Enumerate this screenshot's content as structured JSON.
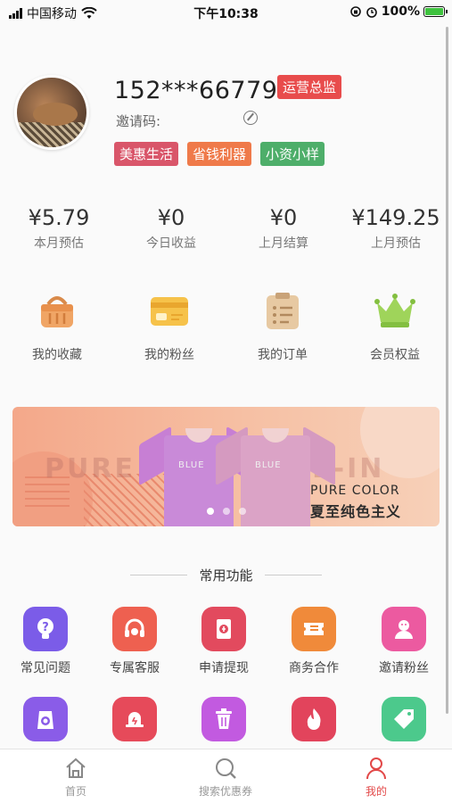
{
  "status_bar": {
    "carrier": "中国移动",
    "time": "下午10:38",
    "battery": "100%"
  },
  "profile": {
    "phone": "152***66779",
    "role_badge": "运营总监",
    "invite_label": "邀请码:",
    "tags": [
      {
        "label": "美惠生活",
        "color": "#d9566a"
      },
      {
        "label": "省钱利器",
        "color": "#ef7a4a"
      },
      {
        "label": "小资小样",
        "color": "#4eae6a"
      }
    ]
  },
  "stats": [
    {
      "value": "¥5.79",
      "label": "本月预估"
    },
    {
      "value": "¥0",
      "label": "今日收益"
    },
    {
      "value": "¥0",
      "label": "上月结算"
    },
    {
      "value": "¥149.25",
      "label": "上月预估"
    }
  ],
  "quick_actions": [
    {
      "label": "我的收藏",
      "icon": "basket-icon"
    },
    {
      "label": "我的粉丝",
      "icon": "card-icon"
    },
    {
      "label": "我的订单",
      "icon": "clipboard-icon"
    },
    {
      "label": "会员权益",
      "icon": "crown-icon"
    }
  ],
  "banner": {
    "bg_text_left": "PURE",
    "bg_text_right": "IE-IN",
    "shirt_label": "BLUE",
    "title_en": "PURE COLOR",
    "title_cn": "夏至纯色主义",
    "active_dot": 1,
    "dot_count": 3
  },
  "common_functions": {
    "title": "常用功能",
    "row1": [
      {
        "label": "常见问题",
        "icon": "question-bulb-icon",
        "color": "#7b5ce8"
      },
      {
        "label": "专属客服",
        "icon": "headset-icon",
        "color": "#ee6050"
      },
      {
        "label": "申请提现",
        "icon": "withdraw-icon",
        "color": "#e24a5e"
      },
      {
        "label": "商务合作",
        "icon": "ticket-icon",
        "color": "#f08a3a"
      },
      {
        "label": "邀请粉丝",
        "icon": "invite-user-icon",
        "color": "#ec5aa0"
      }
    ],
    "row2": [
      {
        "icon": "camera-icon",
        "color": "#8a5ce8"
      },
      {
        "icon": "bell-icon",
        "color": "#e64a5a"
      },
      {
        "icon": "trash-icon",
        "color": "#c25ae0"
      },
      {
        "icon": "fire-icon",
        "color": "#e2445c"
      },
      {
        "icon": "tag-icon",
        "color": "#4cc98c"
      }
    ]
  },
  "tab_bar": [
    {
      "label": "首页",
      "icon": "home-icon",
      "active": false
    },
    {
      "label": "搜索优惠券",
      "icon": "search-icon",
      "active": false
    },
    {
      "label": "我的",
      "icon": "user-icon",
      "active": true
    }
  ]
}
